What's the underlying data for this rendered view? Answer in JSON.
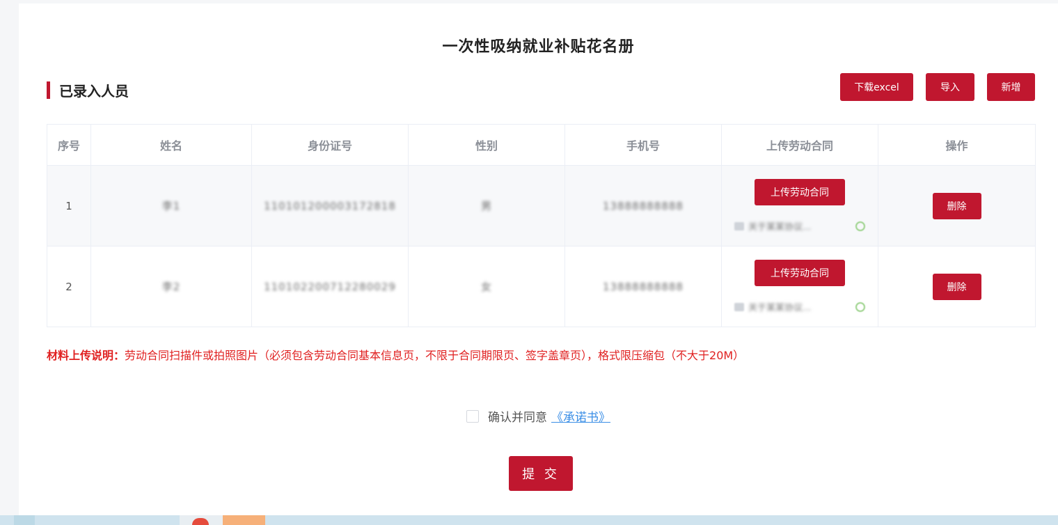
{
  "page": {
    "title": "一次性吸纳就业补贴花名册",
    "section_title": "已录入人员"
  },
  "toolbar": {
    "download_label": "下载excel",
    "import_label": "导入",
    "add_label": "新增"
  },
  "table": {
    "headers": [
      "序号",
      "姓名",
      "身份证号",
      "性别",
      "手机号",
      "上传劳动合同",
      "操作"
    ],
    "upload_label": "上传劳动合同",
    "delete_label": "删除",
    "rows": [
      {
        "index": "1",
        "name": "李1",
        "id_number": "110101200003172818",
        "gender": "男",
        "phone": "13888888888",
        "file_name": "关于某某协议..."
      },
      {
        "index": "2",
        "name": "李2",
        "id_number": "110102200712280029",
        "gender": "女",
        "phone": "13888888888",
        "file_name": "关于某某协议..."
      }
    ]
  },
  "note": {
    "label": "材料上传说明：",
    "text": "劳动合同扫描件或拍照图片（必须包含劳动合同基本信息页，不限于合同期限页、签字盖章页），格式限压缩包（不大于20M）"
  },
  "agreement": {
    "text": "确认并同意",
    "link_text": "《承诺书》"
  },
  "submit_label": "提 交",
  "colors": {
    "primary": "#c0172f",
    "note": "#e02020",
    "link": "#3a8ee6"
  }
}
